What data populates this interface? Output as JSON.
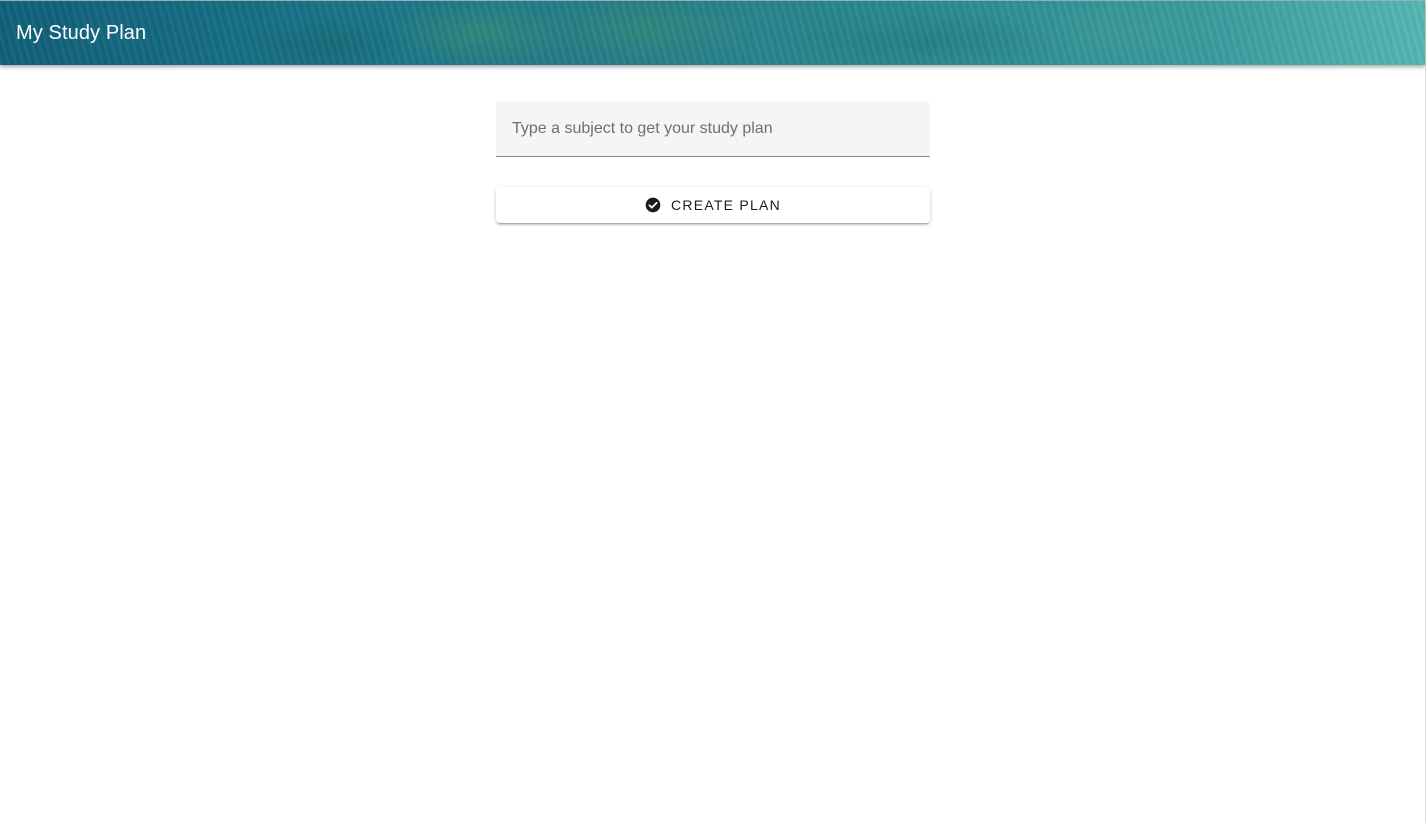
{
  "header": {
    "title": "My Study Plan"
  },
  "subject_field": {
    "value": "",
    "placeholder": "Type a subject to get your study plan"
  },
  "create_button": {
    "label": "CREATE PLAN",
    "icon": "check-circle-icon"
  },
  "colors": {
    "header_gradient_start": "#11607a",
    "header_gradient_end": "#55b7b3",
    "header_text": "#ffffff",
    "field_background": "#f5f5f5",
    "button_text": "#1c1c1c"
  }
}
